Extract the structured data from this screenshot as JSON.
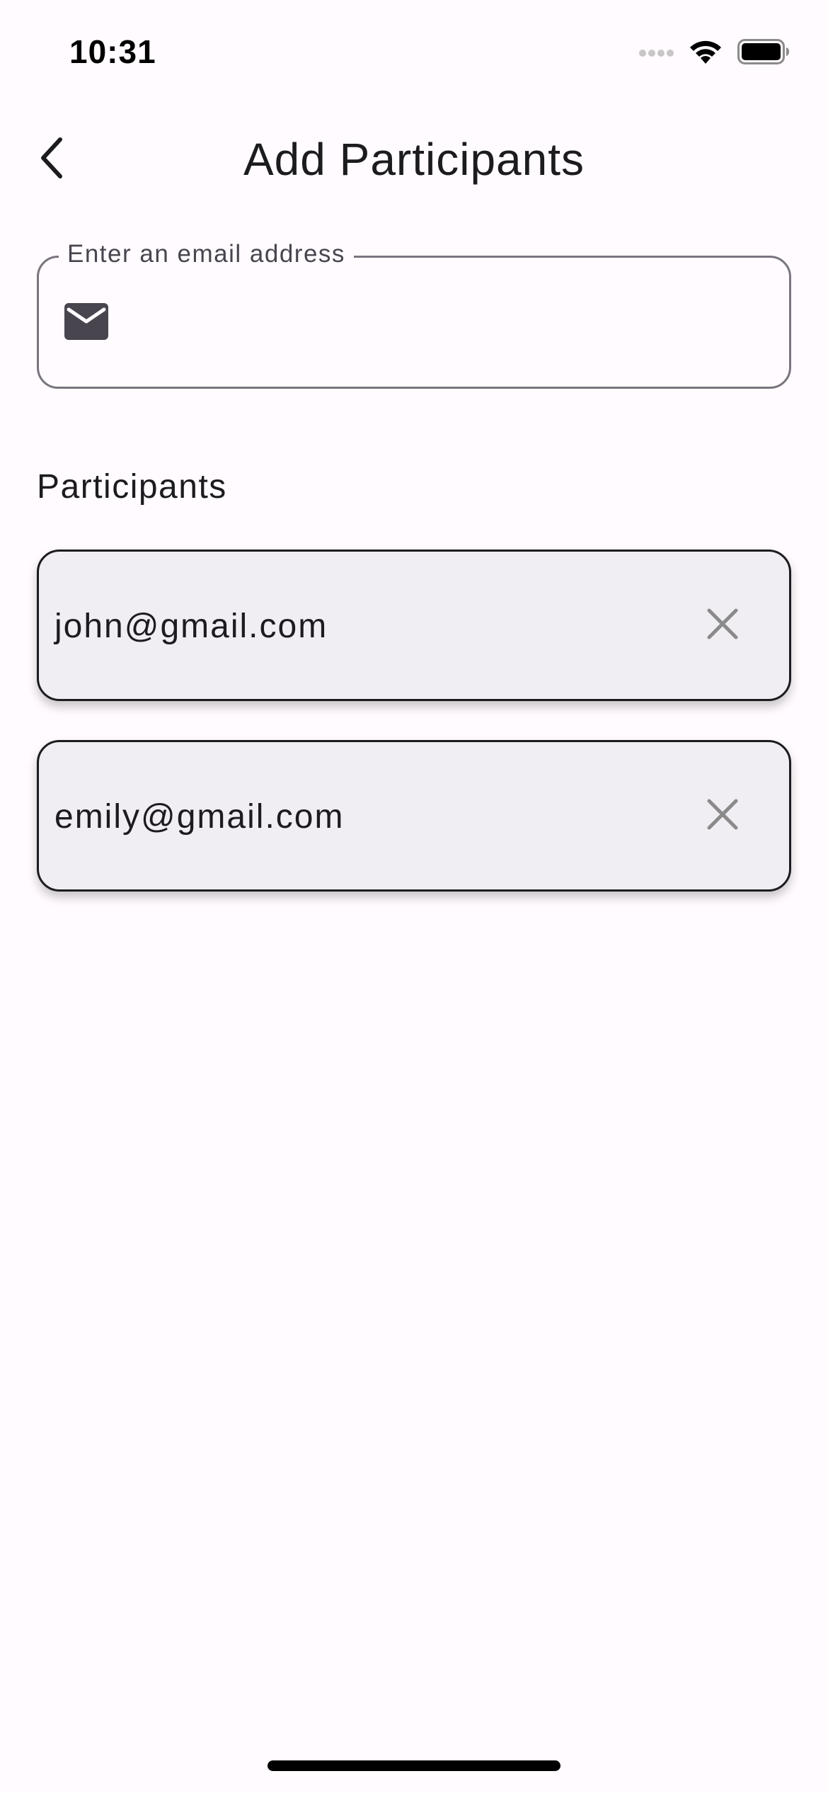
{
  "status_bar": {
    "time": "10:31",
    "icons": [
      "signal-icon",
      "wifi-icon",
      "battery-icon"
    ]
  },
  "header": {
    "title": "Add Participants",
    "back_icon": "chevron-left-icon"
  },
  "email_field": {
    "label": "Enter an email address",
    "value": "",
    "icon": "mail-icon"
  },
  "participants": {
    "heading": "Participants",
    "items": [
      {
        "email": "john@gmail.com",
        "remove_icon": "close-icon"
      },
      {
        "email": "emily@gmail.com",
        "remove_icon": "close-icon"
      }
    ]
  },
  "colors": {
    "background": "#fffbfe",
    "card_background": "#f0edf3",
    "outline": "#79747e",
    "text": "#1c1b1f",
    "remove_icon": "#8a8a8a"
  }
}
